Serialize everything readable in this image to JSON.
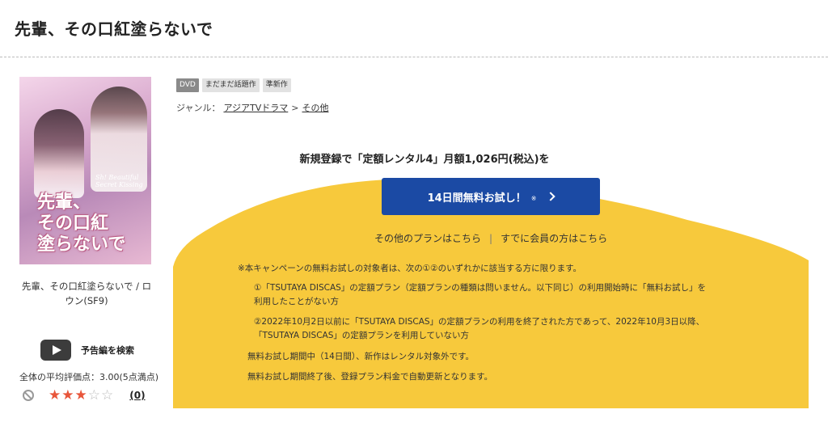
{
  "page": {
    "title": "先輩、その口紅塗らないで"
  },
  "cover": {
    "title_jp": "先輩、\nその口紅\n塗らないで",
    "title_en": "Sh! Beautiful Secret Kissing"
  },
  "left": {
    "work_title": "先輩、その口紅塗らないで / ロウン(SF9)",
    "trailer_label": "予告編を検索",
    "rating_label": "全体の平均評価点：",
    "rating_value": "3.00(5点満点)",
    "rating_stars": 3,
    "rating_max": 5,
    "review_count": "(0)"
  },
  "tags": [
    "DVD",
    "まだまだ話題作",
    "準新作"
  ],
  "genre": {
    "label": "ジャンル：",
    "items": [
      "アジアTVドラマ",
      "その他"
    ],
    "separator": ">"
  },
  "campaign": {
    "headline": "新規登録で「定額レンタル4」月額1,026円(税込)を",
    "button_label": "14日間無料お試し！",
    "button_mark": "※",
    "link_other_plans": "その他のプランはこちら",
    "link_separator": "|",
    "link_members": "すでに会員の方はこちら"
  },
  "notes": {
    "lead": "※本キャンペーンの無料お試しの対象者は、次の①②のいずれかに該当する方に限ります。",
    "item1": "①「TSUTAYA DISCAS」の定額プラン（定額プランの種類は問いません。以下同じ）の利用開始時に「無料お試し」を\n利用したことがない方",
    "item2": "②2022年10月2日以前に「TSUTAYA DISCAS」の定額プランの利用を終了された方であって、2022年10月3日以降、\n「TSUTAYA DISCAS」の定額プランを利用していない方",
    "plain1": "無料お試し期間中（14日間）、新作はレンタル対象外です。",
    "plain2": "無料お試し期間終了後、登録プラン料金で自動更新となります。"
  },
  "colors": {
    "accent_yellow": "#f7c93c",
    "button_blue": "#1b4aa4",
    "star_on": "#e8553a"
  }
}
